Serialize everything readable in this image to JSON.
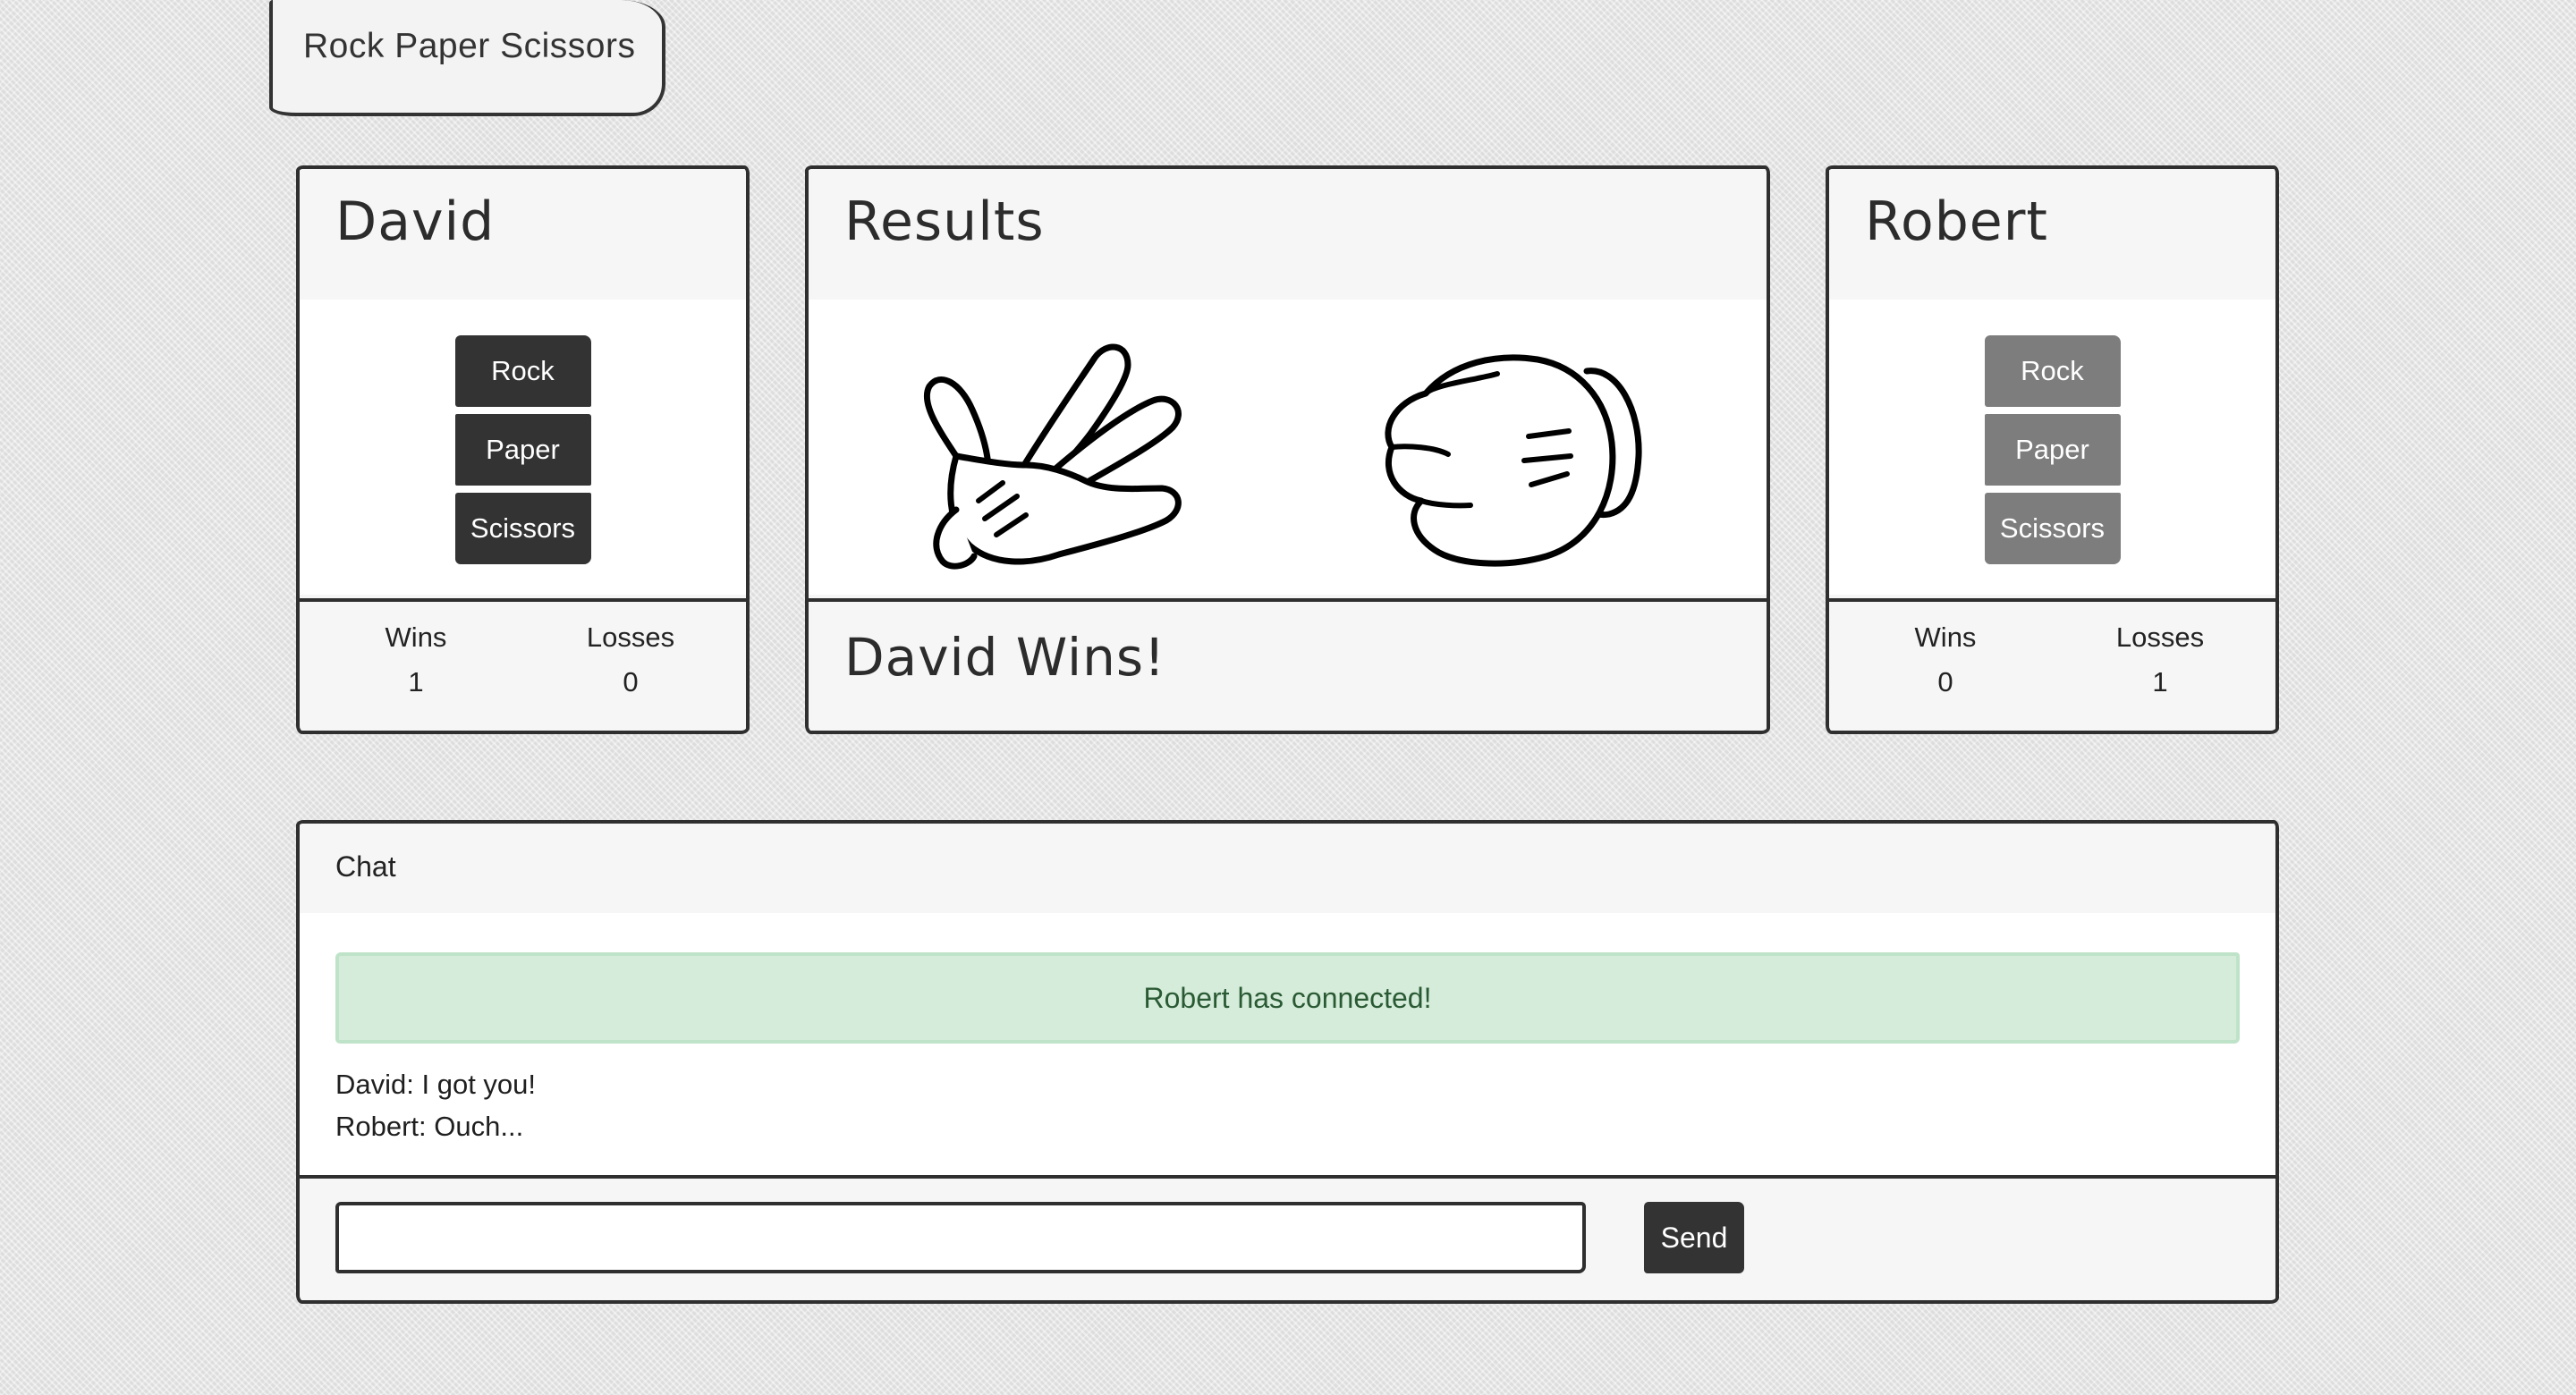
{
  "app": {
    "title": "Rock Paper Scissors"
  },
  "player_left": {
    "name": "David",
    "choices": [
      "Rock",
      "Paper",
      "Scissors"
    ],
    "wins_label": "Wins",
    "wins": "1",
    "losses_label": "Losses",
    "losses": "0"
  },
  "results": {
    "title": "Results",
    "left_hand": "scissors-hand-icon",
    "right_hand": "rock-fist-icon",
    "outcome": "David Wins!"
  },
  "player_right": {
    "name": "Robert",
    "choices": [
      "Rock",
      "Paper",
      "Scissors"
    ],
    "wins_label": "Wins",
    "wins": "0",
    "losses_label": "Losses",
    "losses": "1"
  },
  "chat": {
    "title": "Chat",
    "alert": "Robert has connected!",
    "messages": [
      "David: I got you!",
      "Robert: Ouch..."
    ],
    "input_value": "",
    "send_label": "Send"
  },
  "colors": {
    "dark_button": "#333333",
    "disabled_button": "#7d7d7d",
    "alert_bg": "#d5ecdb",
    "alert_text": "#2a5a33"
  }
}
